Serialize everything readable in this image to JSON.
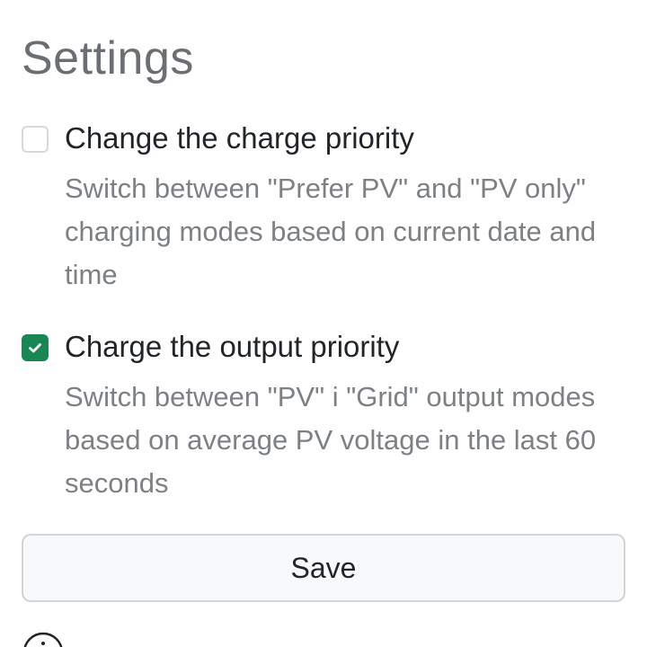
{
  "page": {
    "title": "Settings"
  },
  "options": [
    {
      "label": "Change the charge priority",
      "description": "Switch between \"Prefer PV\" and \"PV only\" charging modes based on current date and time",
      "checked": false
    },
    {
      "label": "Charge the output priority",
      "description": "Switch between \"PV\" i \"Grid\" output modes based on average PV voltage in the last 60 seconds",
      "checked": true
    }
  ],
  "save_button": {
    "label": "Save"
  },
  "icons": {
    "checkbox_check": "check-icon",
    "footer": "info-icon"
  },
  "colors": {
    "accent": "#198754",
    "title": "#6b6f73",
    "text": "#212529",
    "muted": "#7d8186",
    "border": "#d3d6d9"
  }
}
